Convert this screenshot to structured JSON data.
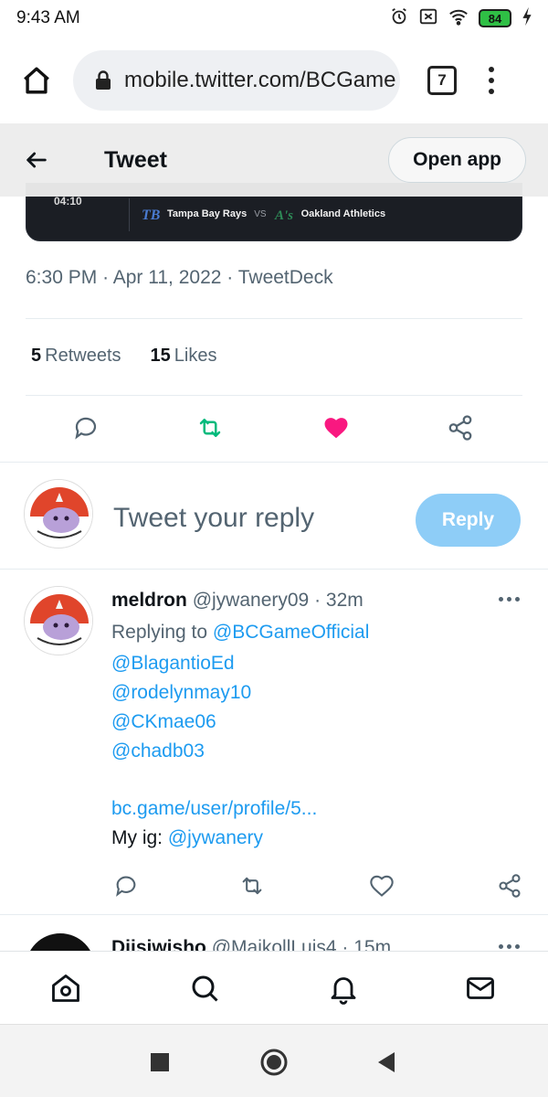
{
  "status_bar": {
    "time": "9:43 AM",
    "battery": "84",
    "icons": [
      "alarm-icon",
      "notification-icon",
      "wifi-icon",
      "battery-icon",
      "charging-icon"
    ]
  },
  "browser": {
    "url": "mobile.twitter.com/BCGame",
    "tab_count": "7"
  },
  "header": {
    "title": "Tweet",
    "open_app": "Open app"
  },
  "media": {
    "time": "04:10",
    "team_home": "Tampa Bay Rays",
    "vs": "VS",
    "team_away": "Oakland Athletics"
  },
  "tweet": {
    "time": "6:30 PM",
    "date": "Apr 11, 2022",
    "source": "TweetDeck",
    "retweets_count": "5",
    "retweets_label": "Retweets",
    "likes_count": "15",
    "likes_label": "Likes"
  },
  "reply_box": {
    "placeholder": "Tweet your reply",
    "button": "Reply"
  },
  "reply_tweet": {
    "name": "meldron",
    "handle": "@jywanery09",
    "age": "32m",
    "replying_prefix": "Replying to",
    "mentions": [
      "@BCGameOfficial",
      "@BlagantioEd",
      "@rodelynmay10",
      "@CKmae06",
      "@chadb03"
    ],
    "link": "bc.game/user/profile/5...",
    "ig_prefix": "My ig:",
    "ig_handle": "@jywanery"
  },
  "next_tweet": {
    "name": "Djisiwisho",
    "handle": "@MaikollLuis4",
    "age": "15m"
  },
  "colors": {
    "link": "#1d9bf0",
    "retweet": "#00ba7c",
    "like": "#f91880",
    "reply_button": "#8ecdf7"
  }
}
